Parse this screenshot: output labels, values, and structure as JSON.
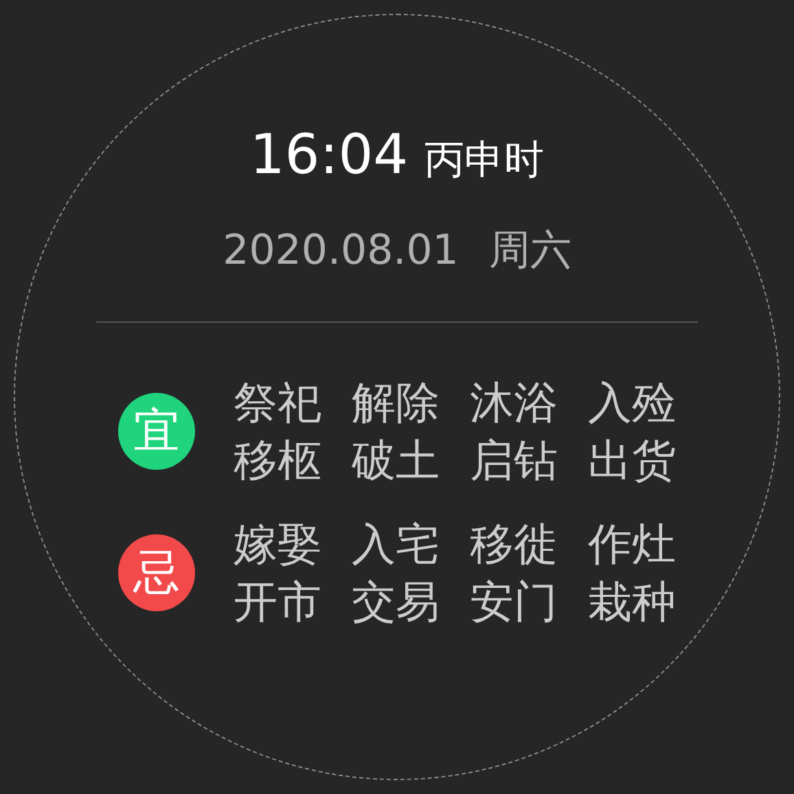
{
  "time": "16:04",
  "hour_name": "丙申时",
  "date": "2020.08.01",
  "weekday": "周六",
  "groups": [
    {
      "label": "宜",
      "color": "#1fd47d",
      "items": [
        "祭祀",
        "解除",
        "沐浴",
        "入殓",
        "移柩",
        "破土",
        "启钻",
        "出货"
      ]
    },
    {
      "label": "忌",
      "color": "#f24a4a",
      "items": [
        "嫁娶",
        "入宅",
        "移徙",
        "作灶",
        "开市",
        "交易",
        "安门",
        "栽种"
      ]
    }
  ]
}
